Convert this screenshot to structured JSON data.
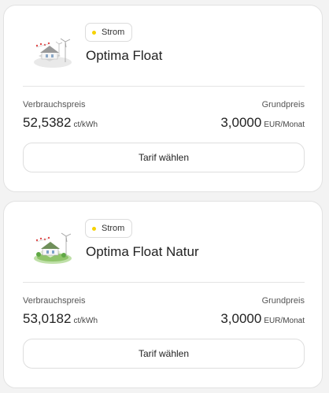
{
  "tariffs": [
    {
      "category": "Strom",
      "category_color": "#f6d200",
      "name": "Optima Float",
      "consumption_label": "Verbrauchspreis",
      "consumption_value": "52,5382",
      "consumption_unit": "ct/kWh",
      "base_label": "Grundpreis",
      "base_value": "3,0000",
      "base_unit": "EUR/Monat",
      "button_label": "Tarif wählen",
      "illustration_icon": "house-wind-turbine-illustration"
    },
    {
      "category": "Strom",
      "category_color": "#f6d200",
      "name": "Optima Float Natur",
      "consumption_label": "Verbrauchspreis",
      "consumption_value": "53,0182",
      "consumption_unit": "ct/kWh",
      "base_label": "Grundpreis",
      "base_value": "3,0000",
      "base_unit": "EUR/Monat",
      "button_label": "Tarif wählen",
      "illustration_icon": "green-house-wind-turbine-illustration"
    }
  ]
}
